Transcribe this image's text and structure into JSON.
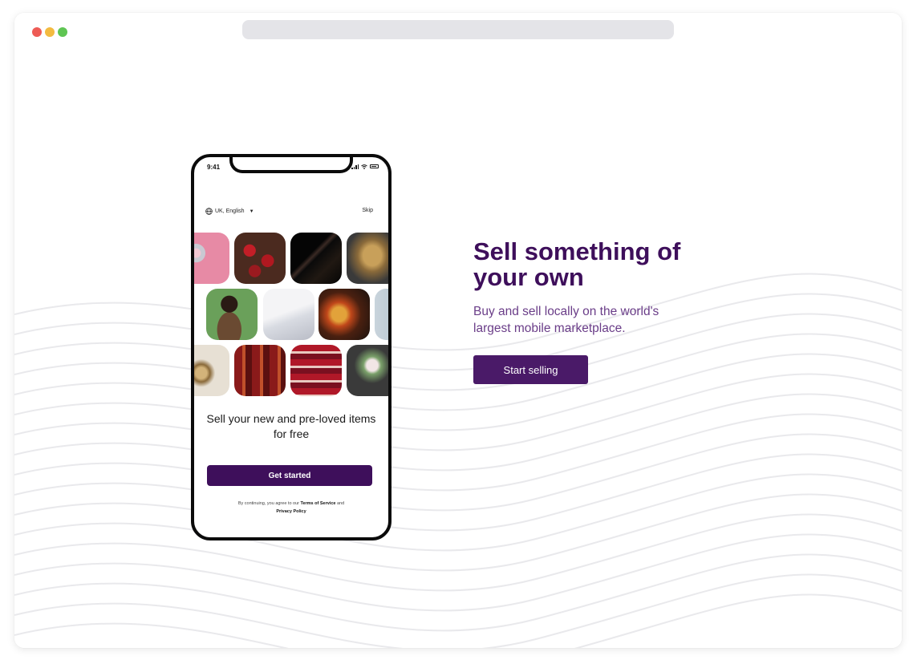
{
  "window": {
    "controls": [
      "close",
      "minimize",
      "maximize"
    ]
  },
  "phone": {
    "status_time": "9:41",
    "language_label": "UK, English",
    "skip_label": "Skip",
    "tagline": "Sell your new and pre-loved items for free",
    "get_started_label": "Get started",
    "legal_prefix": "By continuing, you agree to our ",
    "terms_label": "Terms of Service",
    "legal_mid": " and ",
    "privacy_label": "Privacy Policy",
    "icons": [
      "globe-icon",
      "caret-down-icon",
      "signal-icon",
      "wifi-icon",
      "battery-icon"
    ]
  },
  "hero": {
    "headline": "Sell something of your own",
    "subcopy": "Buy and sell locally on the world's largest mobile marketplace.",
    "cta_label": "Start selling"
  },
  "colors": {
    "brand": "#3e0f5b",
    "brand_button": "#4a1a68",
    "subcopy": "#6a3d88",
    "window_dot_red": "#ee5b55",
    "window_dot_yellow": "#f3bb40",
    "window_dot_green": "#5fc553"
  }
}
